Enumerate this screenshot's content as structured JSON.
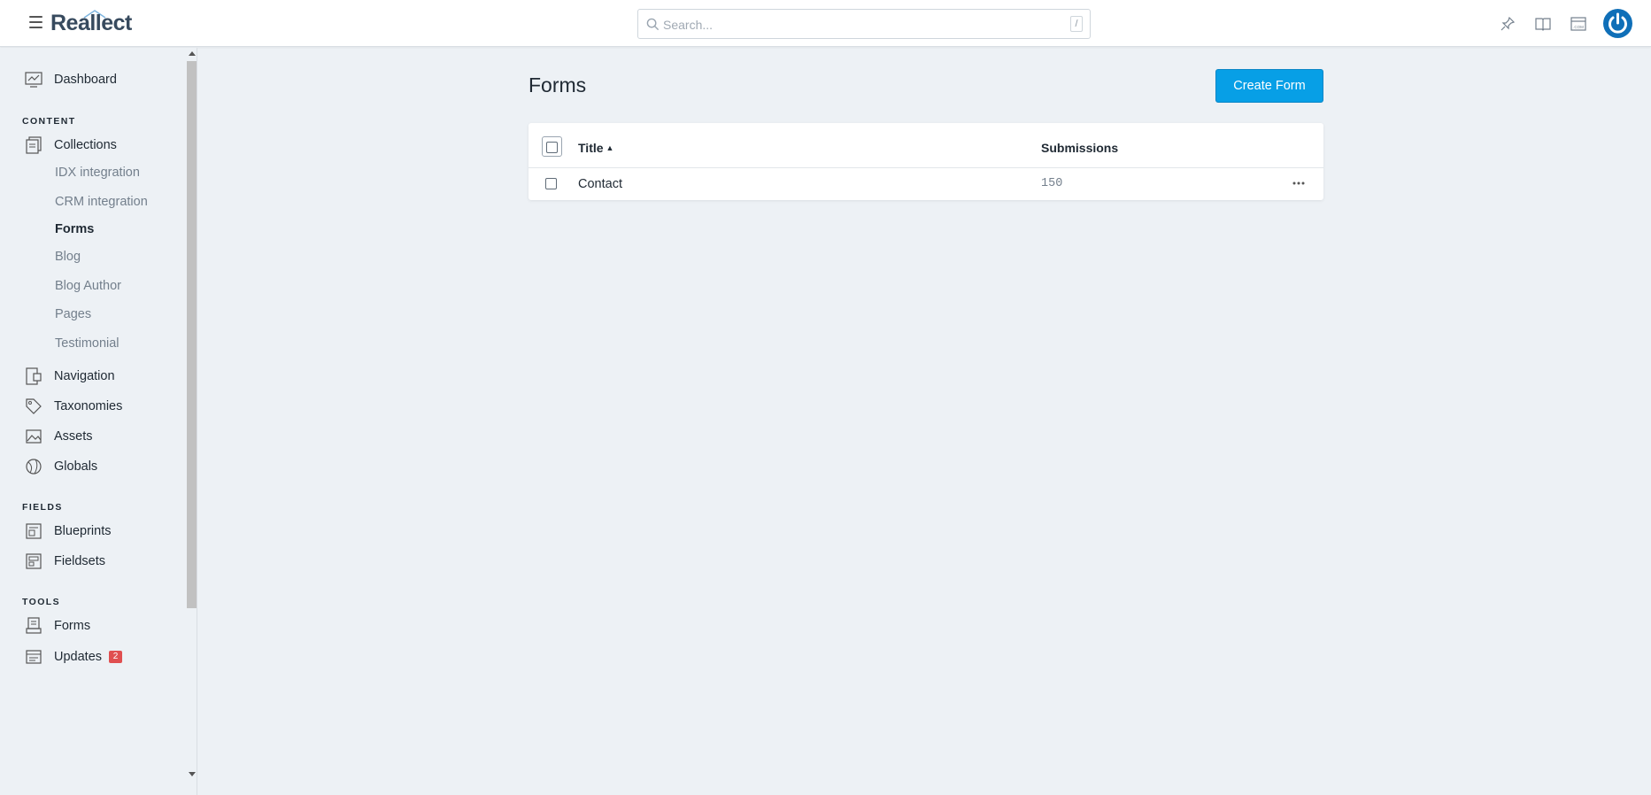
{
  "app": {
    "logo_text": "Reallect"
  },
  "search": {
    "placeholder": "Search...",
    "shortcut": "/"
  },
  "topbar_icons": [
    "pin-icon",
    "docs-book-icon",
    "site-icon",
    "user-avatar-icon"
  ],
  "sidebar": {
    "dashboard": "Dashboard",
    "sections": {
      "content": "CONTENT",
      "fields": "FIELDS",
      "tools": "TOOLS"
    },
    "collections": {
      "label": "Collections",
      "items": [
        "IDX integration",
        "CRM integration",
        "Forms",
        "Blog",
        "Blog Author",
        "Pages",
        "Testimonial"
      ],
      "active": "Forms"
    },
    "content_items": [
      "Navigation",
      "Taxonomies",
      "Assets",
      "Globals"
    ],
    "fields_items": [
      "Blueprints",
      "Fieldsets"
    ],
    "tools_items": [
      "Forms",
      "Updates"
    ],
    "updates_badge": "2"
  },
  "main": {
    "title": "Forms",
    "create_button": "Create Form",
    "table": {
      "columns": [
        "Title",
        "Submissions"
      ],
      "sort_indicator": "▲",
      "rows": [
        {
          "title": "Contact",
          "submissions": "150"
        }
      ]
    }
  },
  "colors": {
    "accent": "#079fe6",
    "badge": "#e04f50",
    "avatar": "#0f6fb8"
  }
}
